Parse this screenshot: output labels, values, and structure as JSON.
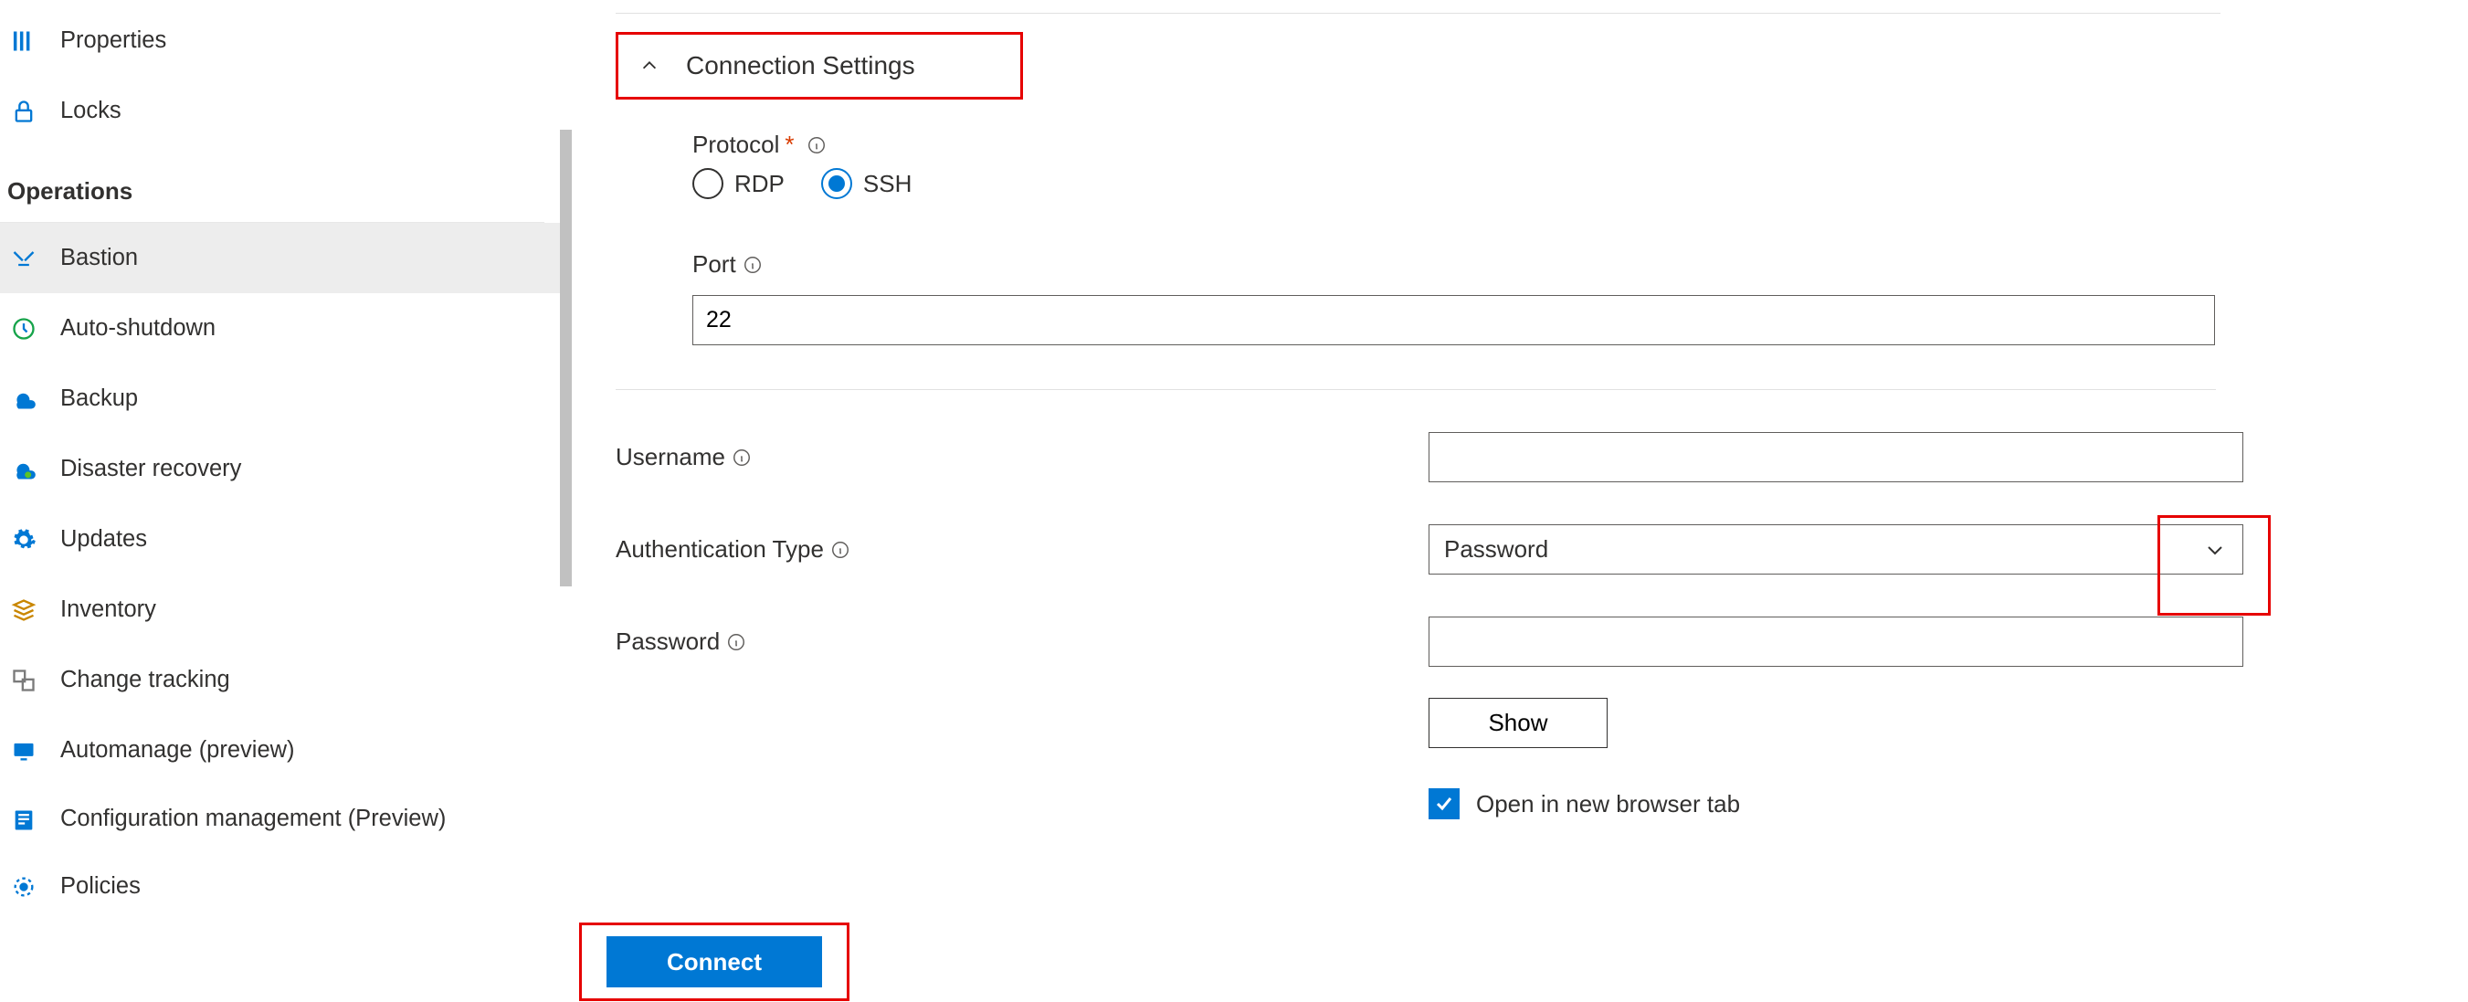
{
  "sidebar": {
    "items_top": [
      {
        "icon": "properties-icon",
        "label": "Properties"
      },
      {
        "icon": "lock-icon",
        "label": "Locks"
      }
    ],
    "section": "Operations",
    "items_ops": [
      {
        "icon": "bastion-icon",
        "label": "Bastion",
        "selected": true
      },
      {
        "icon": "clock-icon",
        "label": "Auto-shutdown"
      },
      {
        "icon": "backup-icon",
        "label": "Backup"
      },
      {
        "icon": "disaster-icon",
        "label": "Disaster recovery"
      },
      {
        "icon": "gear-icon",
        "label": "Updates"
      },
      {
        "icon": "inventory-icon",
        "label": "Inventory"
      },
      {
        "icon": "change-icon",
        "label": "Change tracking"
      },
      {
        "icon": "automanage-icon",
        "label": "Automanage (preview)"
      },
      {
        "icon": "config-icon",
        "label": "Configuration management (Preview)"
      },
      {
        "icon": "policies-icon",
        "label": "Policies"
      }
    ]
  },
  "form": {
    "section_title": "Connection Settings",
    "protocol": {
      "label": "Protocol",
      "options": {
        "rdp": "RDP",
        "ssh": "SSH"
      },
      "selected": "ssh"
    },
    "port": {
      "label": "Port",
      "value": "22"
    },
    "username": {
      "label": "Username",
      "value": ""
    },
    "authtype": {
      "label": "Authentication Type",
      "value": "Password"
    },
    "password": {
      "label": "Password",
      "value": ""
    },
    "show_button": "Show",
    "newtab": {
      "label": "Open in new browser tab",
      "checked": true
    },
    "connect_button": "Connect"
  }
}
